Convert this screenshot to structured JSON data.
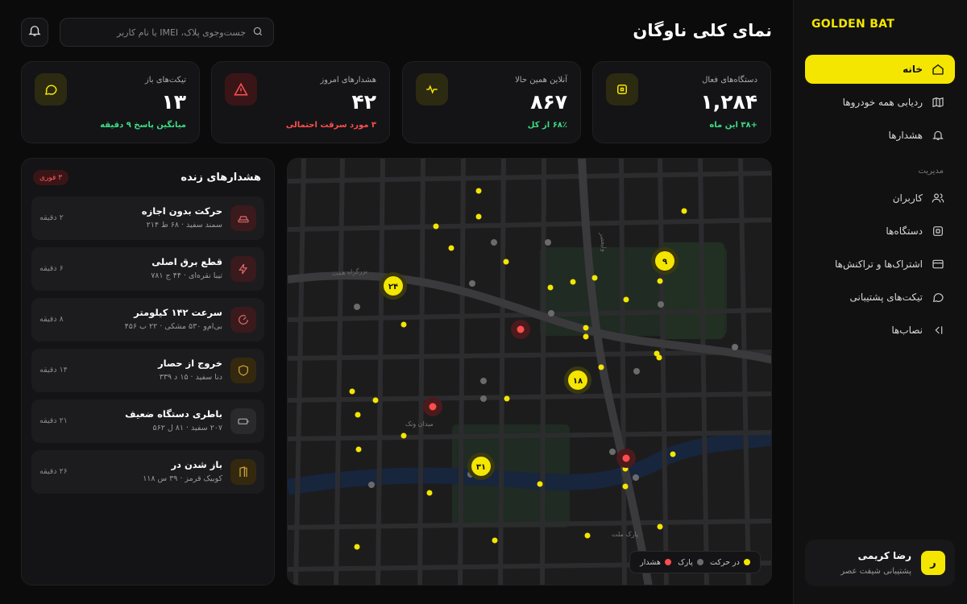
{
  "brand": "GOLDEN BAT",
  "page_title": "نمای کلی ناوگان",
  "search": {
    "placeholder": "جست‌وجوی پلاک، IMEI یا نام کاربر"
  },
  "nav": {
    "items": [
      {
        "label": "خانه",
        "icon": "home-icon",
        "active": true
      },
      {
        "label": "ردیابی همه خودروها",
        "icon": "map-icon"
      },
      {
        "label": "هشدارها",
        "icon": "bell-icon"
      }
    ],
    "section_label": "مدیریت",
    "admin_items": [
      {
        "label": "کاربران",
        "icon": "users-icon"
      },
      {
        "label": "دستگاه‌ها",
        "icon": "chip-icon"
      },
      {
        "label": "اشتراک‌ها و تراکنش‌ها",
        "icon": "card-icon"
      },
      {
        "label": "تیکت‌های پشتیبانی",
        "icon": "chat-icon"
      },
      {
        "label": "نصاب‌ها",
        "icon": "installer-icon"
      }
    ]
  },
  "user": {
    "initial": "ر",
    "name": "رضا کریمی",
    "role": "پشتیبانی شیفت عصر"
  },
  "stats": [
    {
      "label": "دستگاه‌های فعال",
      "value": "۱,۲۸۴",
      "sub": "+۳۸ این ماه",
      "sub_color": "green",
      "icon": "chip-icon"
    },
    {
      "label": "آنلاین همین حالا",
      "value": "۸۶۷",
      "sub": "۶۸٪ از کل",
      "sub_color": "green",
      "icon": "pulse-icon"
    },
    {
      "label": "هشدارهای امروز",
      "value": "۴۲",
      "sub": "۳ مورد سرقت احتمالی",
      "sub_color": "red",
      "icon": "warning-icon"
    },
    {
      "label": "تیکت‌های باز",
      "value": "۱۳",
      "sub": "میانگین پاسخ ۹ دقیقه",
      "sub_color": "green",
      "icon": "chat-icon"
    }
  ],
  "alerts": {
    "title": "هشدارهای زنده",
    "badge": "۳ فوری",
    "items": [
      {
        "title": "حرکت بدون اجازه",
        "desc": "سمند سفید · ۶۸ ط ۲۱۴",
        "time": "۲ دقیقه",
        "severity": "red",
        "icon": "car-icon"
      },
      {
        "title": "قطع برق اصلی",
        "desc": "تیبا نقره‌ای · ۴۴ ج ۷۸۱",
        "time": "۶ دقیقه",
        "severity": "red",
        "icon": "bolt-icon"
      },
      {
        "title": "سرعت ۱۴۲ کیلومتر",
        "desc": "بی‌ام‌و ۵۳۰ مشکی · ۲۲ ب ۴۵۶",
        "time": "۸ دقیقه",
        "severity": "red",
        "icon": "speedometer-icon"
      },
      {
        "title": "خروج از حصار",
        "desc": "دنا سفید · ۱۵ د ۳۳۹",
        "time": "۱۴ دقیقه",
        "severity": "amber",
        "icon": "shield-icon"
      },
      {
        "title": "باطری دستگاه ضعیف",
        "desc": "۲۰۷ سفید · ۸۱ ل ۵۶۲",
        "time": "۲۱ دقیقه",
        "severity": "grey",
        "icon": "battery-icon"
      },
      {
        "title": "باز شدن در",
        "desc": "کوییک قرمز · ۳۹ س ۱۱۸",
        "time": "۲۶ دقیقه",
        "severity": "amber",
        "icon": "door-icon"
      }
    ]
  },
  "map": {
    "street_labels": [
      "بزرگراه همت",
      "ولیعصر",
      "میدان ونک",
      "پارک ملت"
    ],
    "clusters": [
      "۲۴",
      "۹",
      "۱۸",
      "۳۱"
    ],
    "legend": [
      {
        "label": "در حرکت",
        "color": "#f4e600"
      },
      {
        "label": "پارک",
        "color": "#6b6b6b"
      },
      {
        "label": "هشدار",
        "color": "#ff4d4d"
      }
    ]
  },
  "colors": {
    "accent": "#f4e600",
    "success": "#3ddc84",
    "danger": "#ff4d4d",
    "background": "#0b0b0c"
  }
}
